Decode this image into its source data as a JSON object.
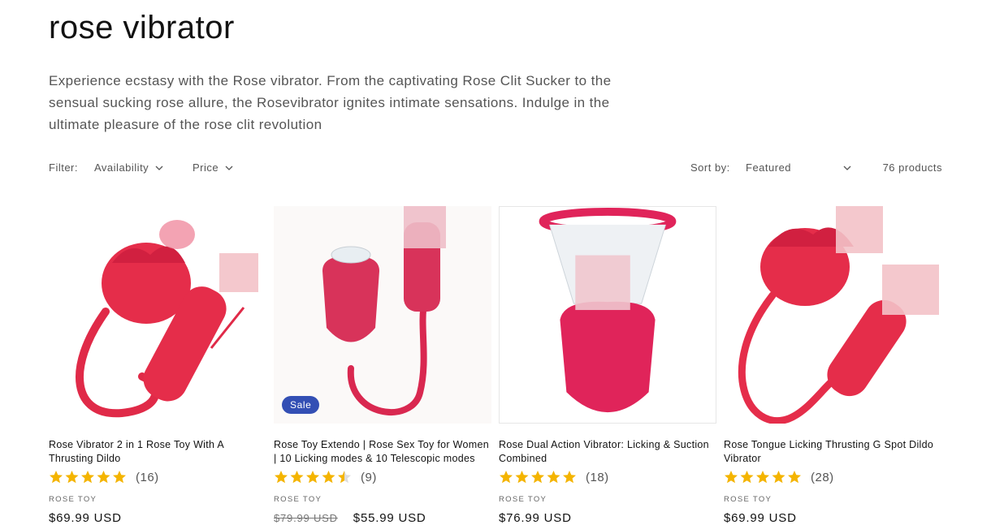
{
  "collection": {
    "title": "rose vibrator",
    "description": "Experience ecstasy with the Rose vibrator. From the captivating Rose Clit Sucker to the sensual sucking rose allure, the Rosevibrator ignites intimate sensations. Indulge in the ultimate pleasure of the rose clit revolution"
  },
  "filters": {
    "label": "Filter:",
    "availability": "Availability",
    "price": "Price",
    "sort_label": "Sort by:",
    "sort_value": "Featured",
    "product_count": "76 products"
  },
  "colors": {
    "product": "#e02a48",
    "sale_badge": "#334fb4",
    "star": "#f4b400"
  },
  "products": [
    {
      "title": "Rose Vibrator 2 in 1 Rose Toy With A Thrusting Dildo",
      "rating": 5,
      "review_count": "(16)",
      "vendor": "ROSE TOY",
      "price": "$69.99 USD",
      "compare_price": "",
      "badge": ""
    },
    {
      "title": "Rose Toy Extendo | Rose Sex Toy for Women | 10 Licking modes & 10 Telescopic modes",
      "rating": 4.5,
      "review_count": "(9)",
      "vendor": "ROSE TOY",
      "price": "$55.99 USD",
      "compare_price": "$79.99 USD",
      "badge": "Sale"
    },
    {
      "title": "Rose Dual Action Vibrator: Licking & Suction Combined",
      "rating": 5,
      "review_count": "(18)",
      "vendor": "ROSE TOY",
      "price": "$76.99 USD",
      "compare_price": "",
      "badge": ""
    },
    {
      "title": "Rose Tongue Licking Thrusting G Spot Dildo Vibrator",
      "rating": 5,
      "review_count": "(28)",
      "vendor": "ROSE TOY",
      "price": "$69.99 USD",
      "compare_price": "",
      "badge": ""
    }
  ]
}
